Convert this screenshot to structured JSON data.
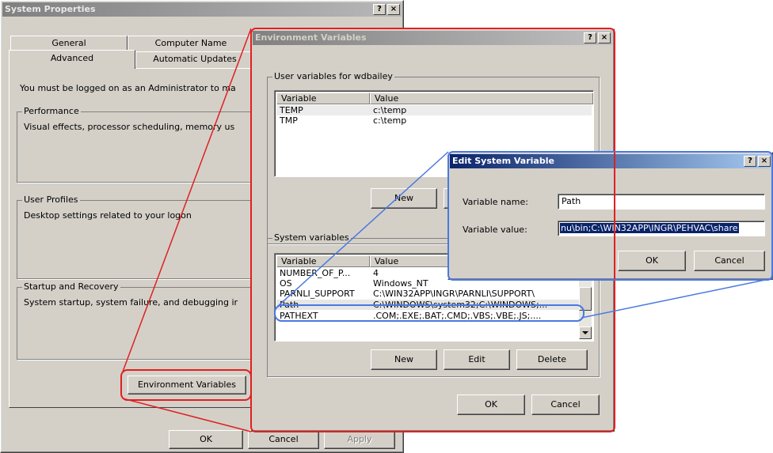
{
  "system_properties": {
    "title": "System Properties",
    "help_btn": "?",
    "close_btn": "×",
    "tabs_row1": [
      "General",
      "Computer Name"
    ],
    "tabs_row2": [
      "Advanced",
      "Automatic Updates"
    ],
    "admin_note": "You must be logged on as an Administrator to ma",
    "performance": {
      "label": "Performance",
      "desc": "Visual effects, processor scheduling, memory us"
    },
    "user_profiles": {
      "label": "User Profiles",
      "desc": "Desktop settings related to your logon"
    },
    "startup_recovery": {
      "label": "Startup and Recovery",
      "desc": "System startup, system failure, and debugging ir"
    },
    "env_button": "Environment Variables",
    "ok": "OK",
    "cancel": "Cancel",
    "apply": "Apply"
  },
  "environment_variables": {
    "title": "Environment Variables",
    "help_btn": "?",
    "close_btn": "×",
    "user_group": "User variables for wdbailey",
    "col_variable": "Variable",
    "col_value": "Value",
    "user_vars": [
      {
        "name": "TEMP",
        "value": "c:\\temp"
      },
      {
        "name": "TMP",
        "value": "c:\\temp"
      }
    ],
    "user_new": "New",
    "system_group": "System variables",
    "system_vars": [
      {
        "name": "NUMBER_OF_P...",
        "value": "4"
      },
      {
        "name": "OS",
        "value": "Windows_NT"
      },
      {
        "name": "PARNLI_SUPPORT",
        "value": "C:\\WIN32APP\\INGR\\PARNLI\\SUPPORT\\"
      },
      {
        "name": "Path",
        "value": "C:\\WINDOWS\\system32;C:\\WINDOWS;..."
      },
      {
        "name": "PATHEXT",
        "value": ".COM;.EXE;.BAT;.CMD;.VBS;.VBE;.JS;...."
      }
    ],
    "sys_new": "New",
    "sys_edit": "Edit",
    "sys_delete": "Delete",
    "ok": "OK",
    "cancel": "Cancel"
  },
  "edit_system_variable": {
    "title": "Edit System Variable",
    "help_btn": "?",
    "close_btn": "×",
    "name_label": "Variable name:",
    "name_value": "Path",
    "value_label": "Variable value:",
    "value_value": "nu\\bin;C:\\WIN32APP\\INGR\\PEHVAC\\share",
    "ok": "OK",
    "cancel": "Cancel"
  },
  "colors": {
    "highlight_red": "#e02020",
    "highlight_blue": "#4a78e0",
    "selection": "#0a246a"
  }
}
